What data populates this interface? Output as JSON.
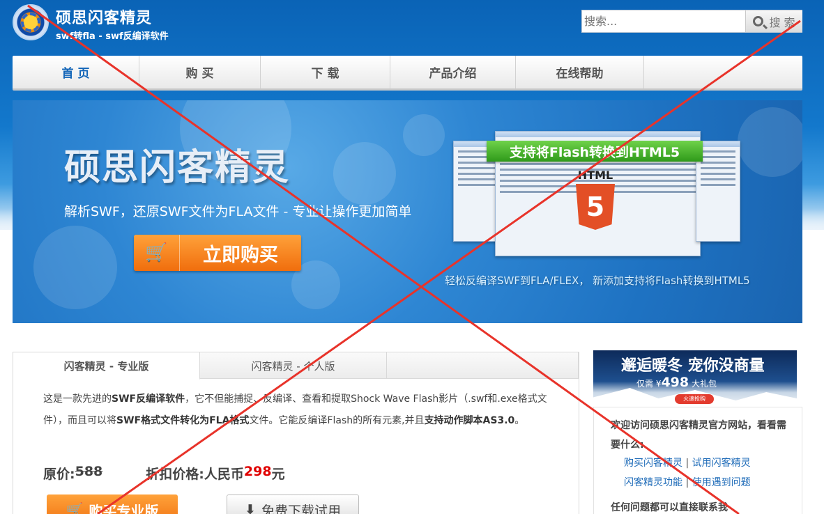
{
  "header": {
    "brand_name": "硕思闪客精灵",
    "brand_sub": "swf转fla - swf反编译软件",
    "search_placeholder": "搜索...",
    "search_button": "搜 索"
  },
  "nav": {
    "items": [
      {
        "label": "首 页",
        "active": true
      },
      {
        "label": "购 买"
      },
      {
        "label": "下 载"
      },
      {
        "label": "产品介绍"
      },
      {
        "label": "在线帮助"
      }
    ]
  },
  "banner": {
    "title": "硕思闪客精灵",
    "subtitle": "解析SWF，还原SWF文件为FLA文件 - 专业让操作更加简单",
    "buy_button": "立即购买",
    "ribbon": "支持将Flash转换到HTML5",
    "html5_label": "HTML",
    "html5_number": "5",
    "caption": "轻松反编译SWF到FLA/FLEX， 新添加支持将Flash转换到HTML5"
  },
  "product": {
    "tabs": [
      {
        "label": "闪客精灵 - 专业版",
        "active": true
      },
      {
        "label": "闪客精灵 - 个人版"
      }
    ],
    "desc": {
      "p1": "这是一款先进的",
      "b1": "SWF反编译软件",
      "p2": "，它不但能捕捉、反编译、查看和提取Shock Wave Flash影片（.swf和.exe格式文件），而且可以将",
      "b2": "SWF格式文件转化为FLA格式",
      "p3": "文件。它能反编译Flash的所有元素,并且",
      "b3": "支持动作脚本AS3.0",
      "p4": "。"
    },
    "orig_label": "原价:",
    "orig_value": "588",
    "sale_label": "折扣价格:人民币",
    "sale_value": "298",
    "sale_unit": "元",
    "buy_button": "购买专业版",
    "download_button": "免费下载试用"
  },
  "sidebar": {
    "ad_title": "邂逅暖冬 宠你没商量",
    "ad_price_label": "仅需 ¥",
    "ad_price_value": "498",
    "ad_price_tag": "大礼包",
    "ad_button": "火速抢购",
    "welcome": "欢迎访问硕思闪客精灵官方网站，看看需要什么:",
    "links": [
      {
        "label": "购买闪客精灵"
      },
      {
        "label": "试用闪客精灵"
      },
      {
        "label": "闪客精灵功能"
      },
      {
        "label": "使用遇到问题"
      }
    ],
    "link_sep": "|",
    "contact": "任何问题都可以直接联系我"
  },
  "colors": {
    "header_blue": "#1378cc",
    "accent_orange": "#f07212",
    "nav_active": "#1466b8",
    "price_red": "#e00000",
    "link_blue": "#1e6bb8",
    "overlay_red": "#e8332a"
  }
}
